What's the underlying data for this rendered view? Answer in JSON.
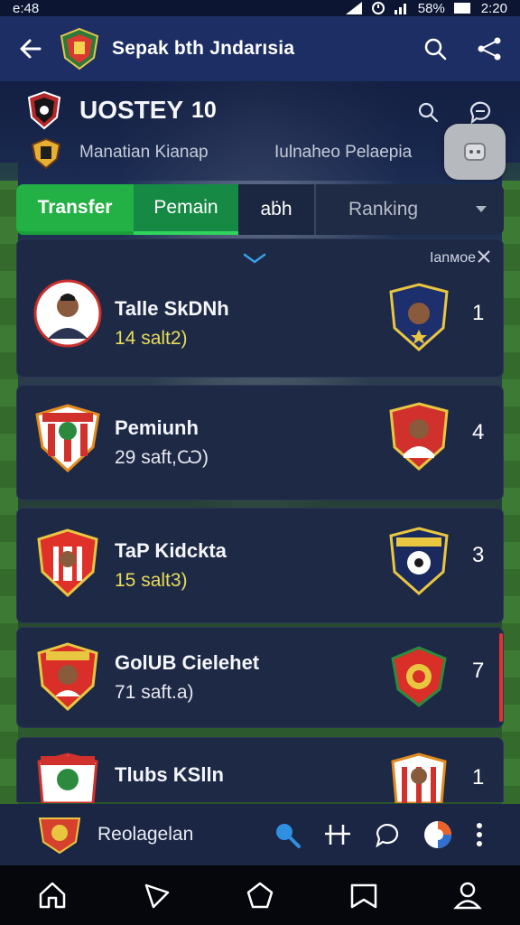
{
  "status_bar": {
    "time_left": "e:48",
    "battery": "58%",
    "time_right": "2:20"
  },
  "app_bar": {
    "title": "Sepak bth Jndarısia",
    "back_icon": "arrow-left-icon",
    "search_icon": "search-icon",
    "share_icon": "share-icon"
  },
  "header": {
    "league_name": "UOSTEY",
    "league_count": "10",
    "subtitle_left": "Manatian  Kianap",
    "subtitle_right": "Iulnaheo Pelaepia"
  },
  "tabs": [
    {
      "label": "Transfer"
    },
    {
      "label": "Pemain"
    },
    {
      "label": "aḃh"
    },
    {
      "label": "Ranking"
    }
  ],
  "list_header": {
    "more_label": "Іаnмое"
  },
  "cards": [
    {
      "name": "Talle SkDNh",
      "meta": "14 salt2)",
      "rank": "1"
    },
    {
      "name": "Pemiunh",
      "meta": "29 saft,Ѡ)",
      "rank": "4"
    },
    {
      "name": "TaP Kidckta",
      "meta": "15 salt3)",
      "rank": "3"
    },
    {
      "name": "GolUB Cielehet",
      "meta": "71 saft.a)",
      "rank": "7"
    },
    {
      "name": "Tlubs KSlln",
      "meta": "",
      "rank": "1"
    }
  ],
  "bottom_bar": {
    "label": "Reolagelan"
  },
  "colors": {
    "primary": "#1c2e64",
    "accent_green": "#23b045",
    "highlight_yellow": "#e7dc5a",
    "red_edge": "#e0332e"
  }
}
